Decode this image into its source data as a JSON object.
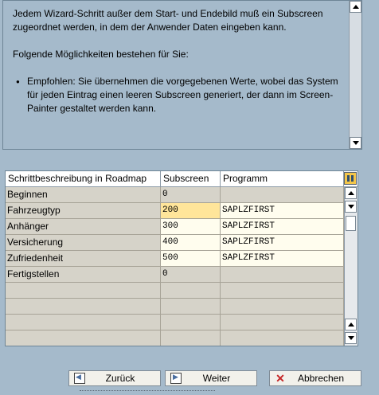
{
  "info": {
    "para1": "Jedem Wizard-Schritt außer dem Start- und Endebild muß ein Subscreen zugeordnet werden, in dem der Anwender Daten eingeben kann.",
    "para2": "Folgende Möglichkeiten bestehen für Sie:",
    "bullet1": "Empfohlen: Sie übernehmen die vorgegebenen Werte, wobei das System für jeden Eintrag einen leeren Subscreen generiert, der dann im Screen-Painter gestaltet werden kann."
  },
  "table": {
    "headers": {
      "step": "Schrittbeschreibung in Roadmap",
      "subscreen": "Subscreen",
      "program": "Programm"
    },
    "rows": [
      {
        "step": "Beginnen",
        "subscreen": "0",
        "program": ""
      },
      {
        "step": "Fahrzeugtyp",
        "subscreen": "200",
        "program": "SAPLZFIRST"
      },
      {
        "step": "Anhänger",
        "subscreen": "300",
        "program": "SAPLZFIRST"
      },
      {
        "step": "Versicherung",
        "subscreen": "400",
        "program": "SAPLZFIRST"
      },
      {
        "step": "Zufriedenheit",
        "subscreen": "500",
        "program": "SAPLZFIRST"
      },
      {
        "step": "Fertigstellen",
        "subscreen": "0",
        "program": ""
      }
    ],
    "focused_row": 1,
    "config_icon": "table-settings-icon"
  },
  "buttons": {
    "back": "Zurück",
    "next": "Weiter",
    "cancel": "Abbrechen"
  },
  "icons": {
    "back": "back-arrow-icon",
    "next": "next-arrow-icon",
    "cancel": "cancel-x-icon"
  }
}
